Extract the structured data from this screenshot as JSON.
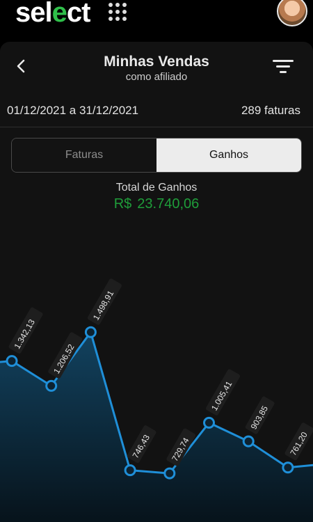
{
  "header": {
    "logo_text": "sel",
    "logo_check": "e",
    "logo_tail": "ct",
    "menu_icon": "grid-icon",
    "avatar_icon": "avatar"
  },
  "page": {
    "title": "Minhas Vendas",
    "subtitle": "como afiliado",
    "date_range": "01/12/2021 a 31/12/2021",
    "invoice_count": "289 faturas"
  },
  "tabs": [
    {
      "label": "Faturas",
      "active": false
    },
    {
      "label": "Ganhos",
      "active": true
    }
  ],
  "summary": {
    "label": "Total de Ganhos",
    "currency": "R$",
    "value": "23.740,06",
    "color": "#1f9d3a"
  },
  "colors": {
    "accent": "#2fbf4a",
    "line": "#1f8fd8",
    "area_top": "#12425f",
    "area_bottom": "#07131b"
  },
  "chart_data": {
    "type": "area",
    "x": [
      1,
      2,
      3,
      4,
      5,
      6,
      7,
      8
    ],
    "labels": [
      "1.342,13",
      "1.206,52",
      "1.498,91",
      "746,43",
      "729,74",
      "1.005,41",
      "903,85",
      "761,20"
    ],
    "values": [
      1342.13,
      1206.52,
      1498.91,
      746.43,
      729.74,
      1005.41,
      903.85,
      761.2
    ],
    "ylim": [
      400,
      1500
    ]
  }
}
